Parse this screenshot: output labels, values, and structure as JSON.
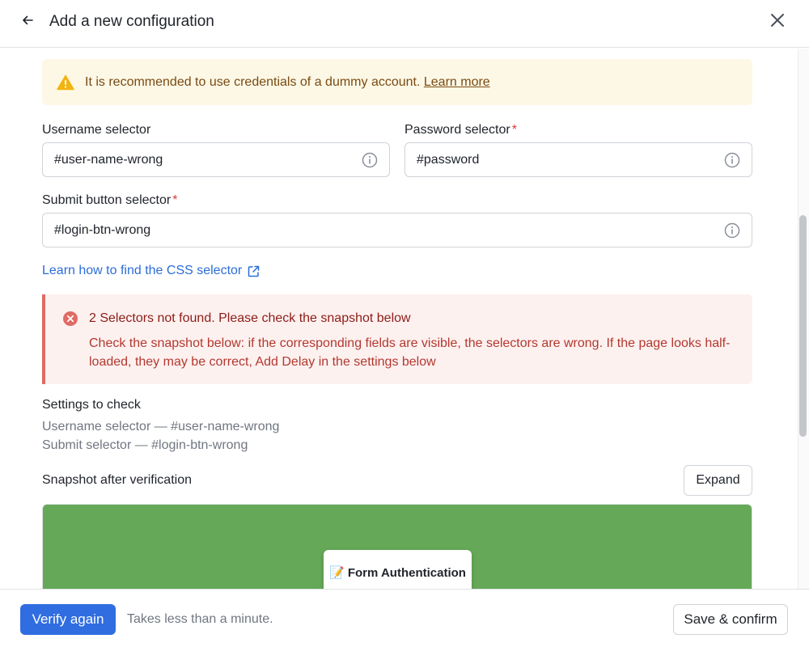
{
  "header": {
    "title": "Add a new configuration",
    "back_icon": "arrow-left-icon",
    "close_icon": "close-icon"
  },
  "warning": {
    "icon": "warning-triangle-icon",
    "text": "It is recommended to use credentials of a dummy account.",
    "link_label": "Learn more",
    "color": "#fdf8e6"
  },
  "fields": {
    "username": {
      "label": "Username selector",
      "value": "#user-name-wrong",
      "required": false
    },
    "password": {
      "label": "Password selector",
      "value": "#password",
      "required": true
    },
    "submit": {
      "label": "Submit button selector",
      "value": "#login-btn-wrong",
      "required": true
    },
    "required_mark": "*"
  },
  "css_link": {
    "label": "Learn how to find the CSS selector",
    "icon": "external-link-icon"
  },
  "error": {
    "icon": "error-circle-icon",
    "title": "2 Selectors not found. Please check the snapshot below",
    "body": "Check the snapshot below: if the corresponding fields are visible, the selectors are wrong. If the page looks half-loaded, they may be correct, Add Delay in the settings below",
    "color": "#e06b64"
  },
  "settings": {
    "title": "Settings to check",
    "lines": [
      "Username selector — #user-name-wrong",
      "Submit selector — #login-btn-wrong"
    ]
  },
  "snapshot": {
    "title": "Snapshot after verification",
    "expand_label": "Expand",
    "card_title": "📝 Form Authentication",
    "background": "#65a857"
  },
  "footer": {
    "verify_label": "Verify again",
    "hint": "Takes less than a minute.",
    "save_label": "Save & confirm",
    "accent": "#2f6de1"
  }
}
